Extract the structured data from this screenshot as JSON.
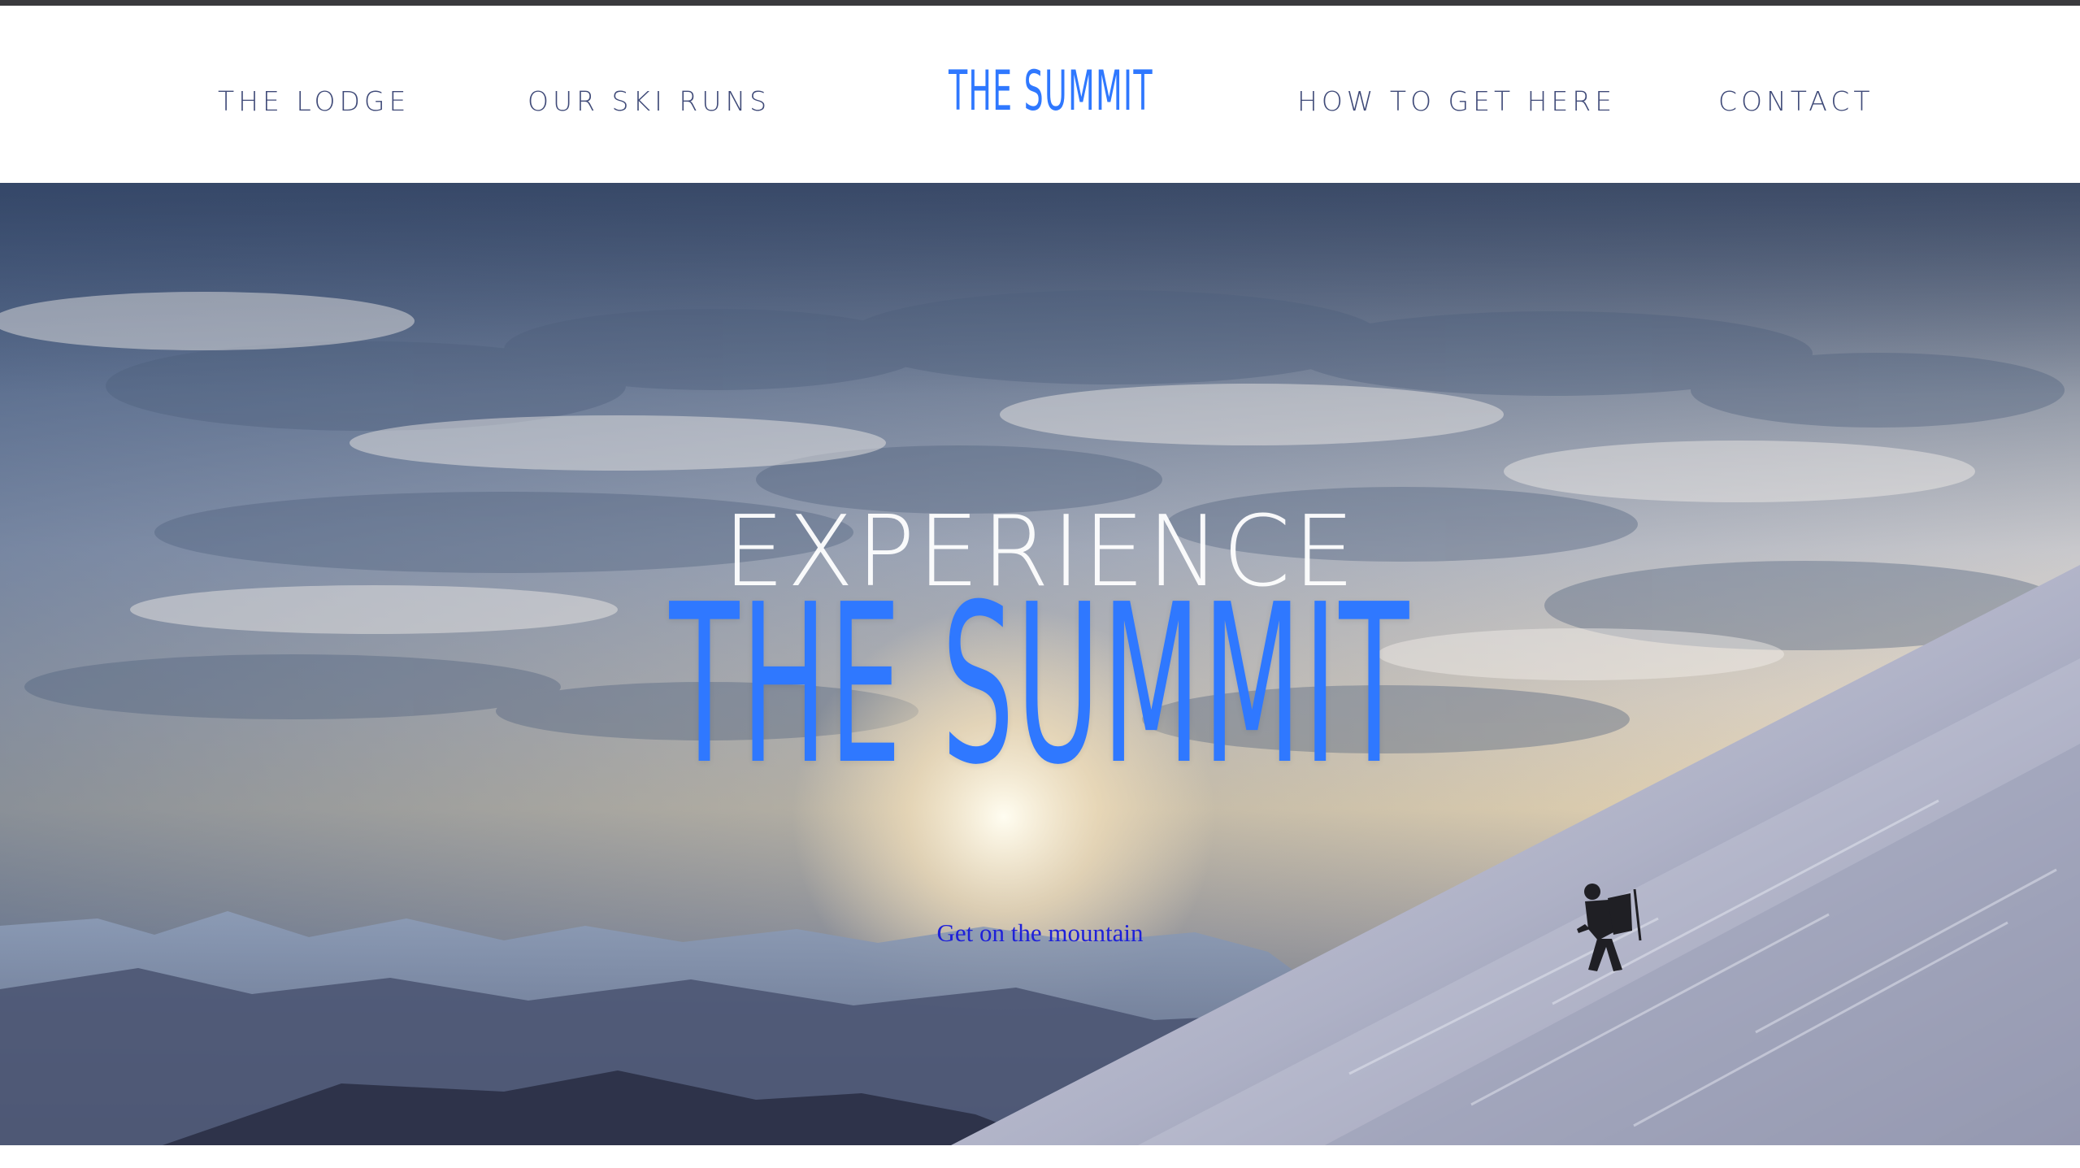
{
  "header": {
    "logo": "THE SUMMIT",
    "nav": {
      "lodge": "THE LODGE",
      "runs": "OUR SKI RUNS",
      "how": "HOW TO GET HERE",
      "contact": "CONTACT"
    }
  },
  "hero": {
    "line1": "EXPERIENCE",
    "line2": "THE SUMMIT",
    "cta": "Get on the mountain",
    "icons": {
      "background": "mountain-skiing-photo"
    }
  },
  "colors": {
    "accent": "#2f78ff",
    "nav": "#3f4a78",
    "link": "#1e20d9"
  }
}
